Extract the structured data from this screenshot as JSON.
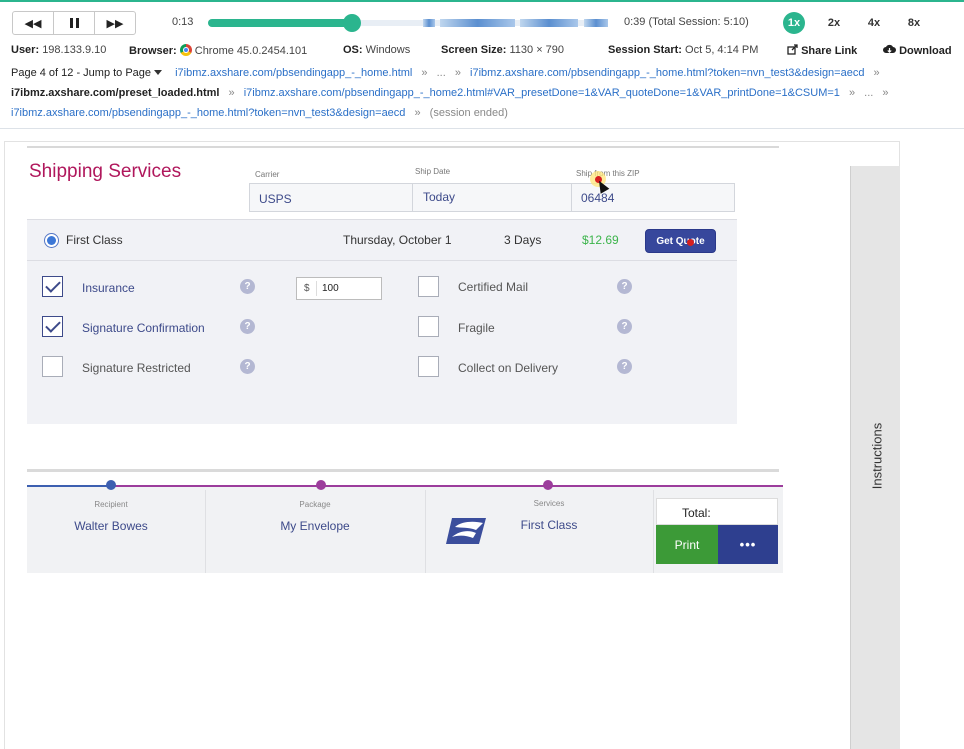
{
  "player": {
    "rewind": "◀◀",
    "forward": "▶▶",
    "current_time": "0:13",
    "total_time": "0:39 (Total Session: 5:10)",
    "progress_fraction": 0.36,
    "speeds": [
      "1x",
      "2x",
      "4x",
      "8x"
    ],
    "active_speed": "1x"
  },
  "session": {
    "user_label": "User:",
    "user_value": "198.133.9.10",
    "browser_label": "Browser:",
    "browser_value": "Chrome 45.0.2454.101",
    "os_label": "OS:",
    "os_value": "Windows",
    "screen_label": "Screen Size:",
    "screen_value": "1130 × 790",
    "start_label": "Session Start:",
    "start_value": "Oct 5, 4:14 PM",
    "share_label": "Share Link",
    "download_label": "Download"
  },
  "breadcrumbs": {
    "page_jump": "Page 4 of 12 - Jump to Page",
    "line1": [
      "i7ibmz.axshare.com/pbsendingapp_-_home.html",
      "...",
      "i7ibmz.axshare.com/pbsendingapp_-_home.html?token=nvn_test3&design=aecd"
    ],
    "line2_current": "i7ibmz.axshare.com/preset_loaded.html",
    "line2": [
      "i7ibmz.axshare.com/pbsendingapp_-_home2.html#VAR_presetDone=1&VAR_quoteDone=1&VAR_printDone=1&CSUM=1",
      "..."
    ],
    "line3": [
      "i7ibmz.axshare.com/pbsendingapp_-_home.html?token=nvn_test3&design=aecd"
    ],
    "line3_end": "(session ended)",
    "sep": "»"
  },
  "shipping": {
    "title": "Shipping Services",
    "carrier_label": "Carrier",
    "carrier_value": "USPS",
    "date_label": "Ship Date",
    "date_value": "Today",
    "zip_label": "Ship from this ZIP",
    "zip_value": "06484",
    "service_name": "First Class",
    "service_date": "Thursday, October 1",
    "service_days": "3 Days",
    "service_price": "$12.69",
    "quote_button": "Get Quote",
    "options_left": [
      {
        "label": "Insurance",
        "checked": true
      },
      {
        "label": "Signature Confirmation",
        "checked": true
      },
      {
        "label": "Signature Restricted",
        "checked": false
      }
    ],
    "options_right": [
      {
        "label": "Certified Mail",
        "checked": false
      },
      {
        "label": "Fragile",
        "checked": false
      },
      {
        "label": "Collect on Delivery",
        "checked": false
      }
    ],
    "help_glyph": "?",
    "insurance_prefix": "$",
    "insurance_value": "100"
  },
  "summary": {
    "recipient_label": "Recipient",
    "recipient_value": "Walter Bowes",
    "package_label": "Package",
    "package_value": "My Envelope",
    "services_label": "Services",
    "services_value": "First Class",
    "total_label": "Total:",
    "print_button": "Print",
    "more_button": "•••"
  },
  "sidebar": {
    "instructions_label": "Instructions"
  },
  "colors": {
    "accent": "#2bb58e",
    "brand": "#b0175c",
    "navy": "#37479c",
    "price": "#3cb44b",
    "progress_blue": "#3d5fb0",
    "progress_purple": "#9c3d9c"
  },
  "icons": {
    "share": "share-icon",
    "download": "cloud-download-icon",
    "browser": "chrome-icon",
    "help": "question-icon",
    "carrier_logo": "usps-eagle-icon"
  }
}
